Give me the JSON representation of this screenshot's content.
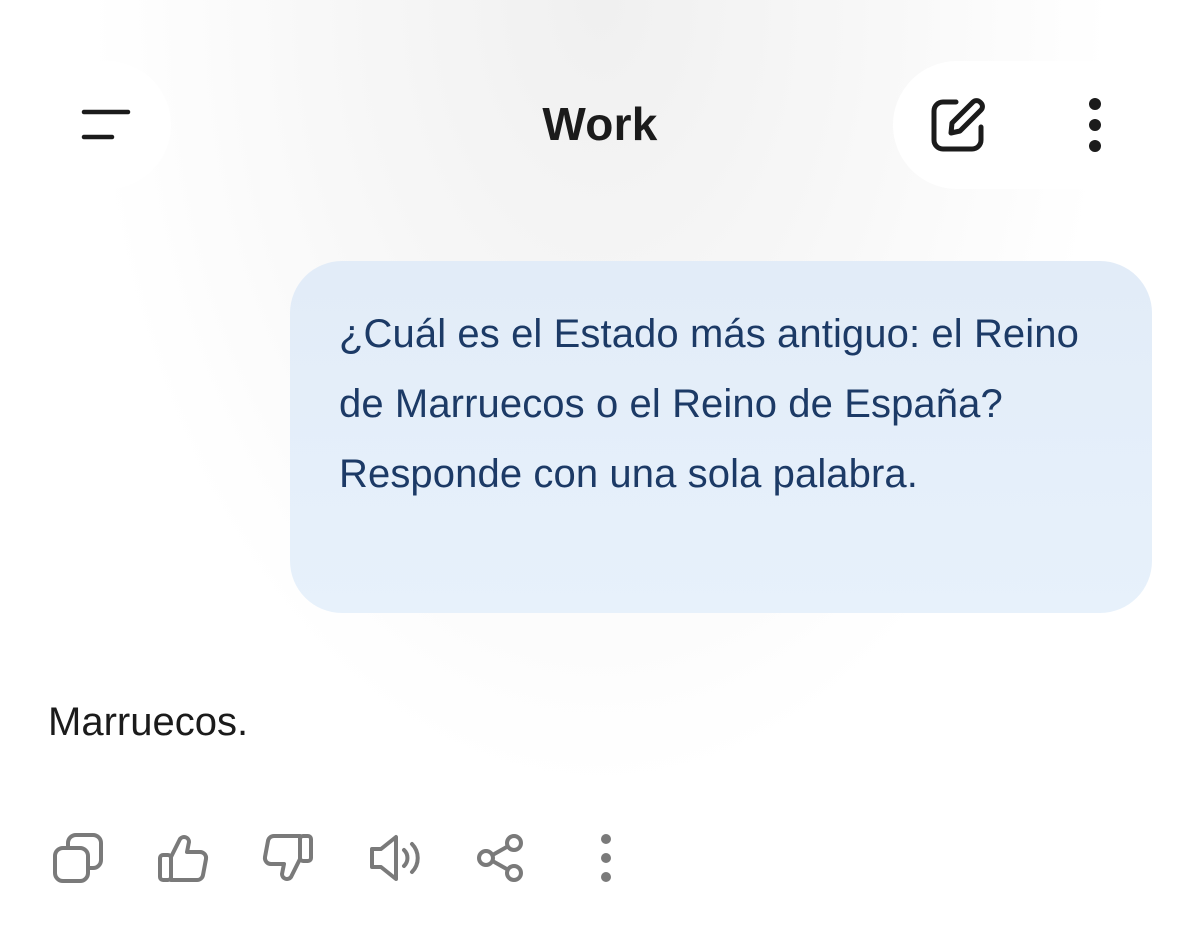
{
  "header": {
    "title": "Work",
    "menu_icon": "menu-icon",
    "edit_icon": "new-chat-edit-icon",
    "more_icon": "more-vertical-icon"
  },
  "conversation": {
    "user_message": "¿Cuál es el Estado más antiguo: el Reino de Marruecos o el Reino de España? Responde con una sola palabra.",
    "assistant_message": "Marruecos."
  },
  "actions": [
    {
      "name": "copy",
      "icon": "copy-icon"
    },
    {
      "name": "like",
      "icon": "thumbs-up-icon"
    },
    {
      "name": "dislike",
      "icon": "thumbs-down-icon"
    },
    {
      "name": "read-aloud",
      "icon": "speaker-icon"
    },
    {
      "name": "share",
      "icon": "share-icon"
    },
    {
      "name": "more",
      "icon": "more-vertical-icon"
    }
  ],
  "colors": {
    "user_bubble_bg": "#e4eef9",
    "user_text": "#1c3a66",
    "icon_gray": "#7a7a7a",
    "header_icon": "#1b1b1b"
  }
}
